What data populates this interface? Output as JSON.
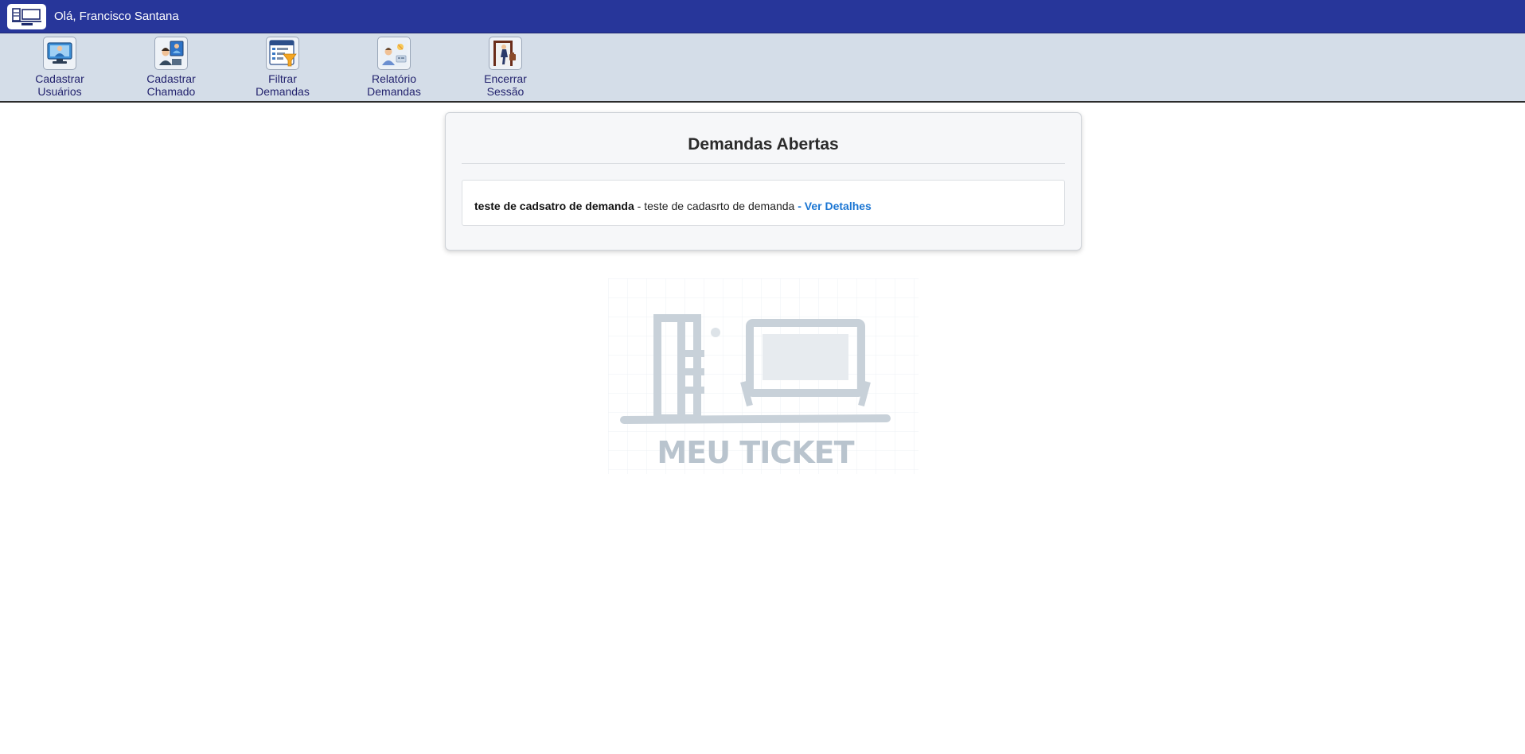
{
  "header": {
    "logo_icon": "meu-ticket-logo-icon",
    "greeting": "Olá, Francisco Santana",
    "background": "#27369a"
  },
  "nav": {
    "items": [
      {
        "id": "cadastrar-usuarios",
        "line1": "Cadastrar",
        "line2": "Usuários",
        "icon": "user-computer-icon"
      },
      {
        "id": "cadastrar-chamado",
        "line1": "Cadastrar",
        "line2": "Chamado",
        "icon": "support-call-icon"
      },
      {
        "id": "filtrar-demandas",
        "line1": "Filtrar",
        "line2": "Demandas",
        "icon": "filter-list-icon"
      },
      {
        "id": "relatorio-demandas",
        "line1": "Relatório",
        "line2": "Demandas",
        "icon": "report-person-icon"
      },
      {
        "id": "encerrar-sessao",
        "line1": "Encerrar",
        "line2": "Sessão",
        "icon": "exit-door-icon"
      }
    ],
    "background": "#d4dde8",
    "label_color": "#23236e"
  },
  "main": {
    "title": "Demandas Abertas",
    "demands": [
      {
        "title": "teste de cadsatro de demanda",
        "separator": " - ",
        "description": "teste de cadasrto de demanda",
        "link_label": " - Ver Detalhes"
      }
    ],
    "link_color": "#1b76d3"
  },
  "watermark": {
    "icon": "meu-ticket-logo-icon",
    "text": "MEU TICKET"
  }
}
